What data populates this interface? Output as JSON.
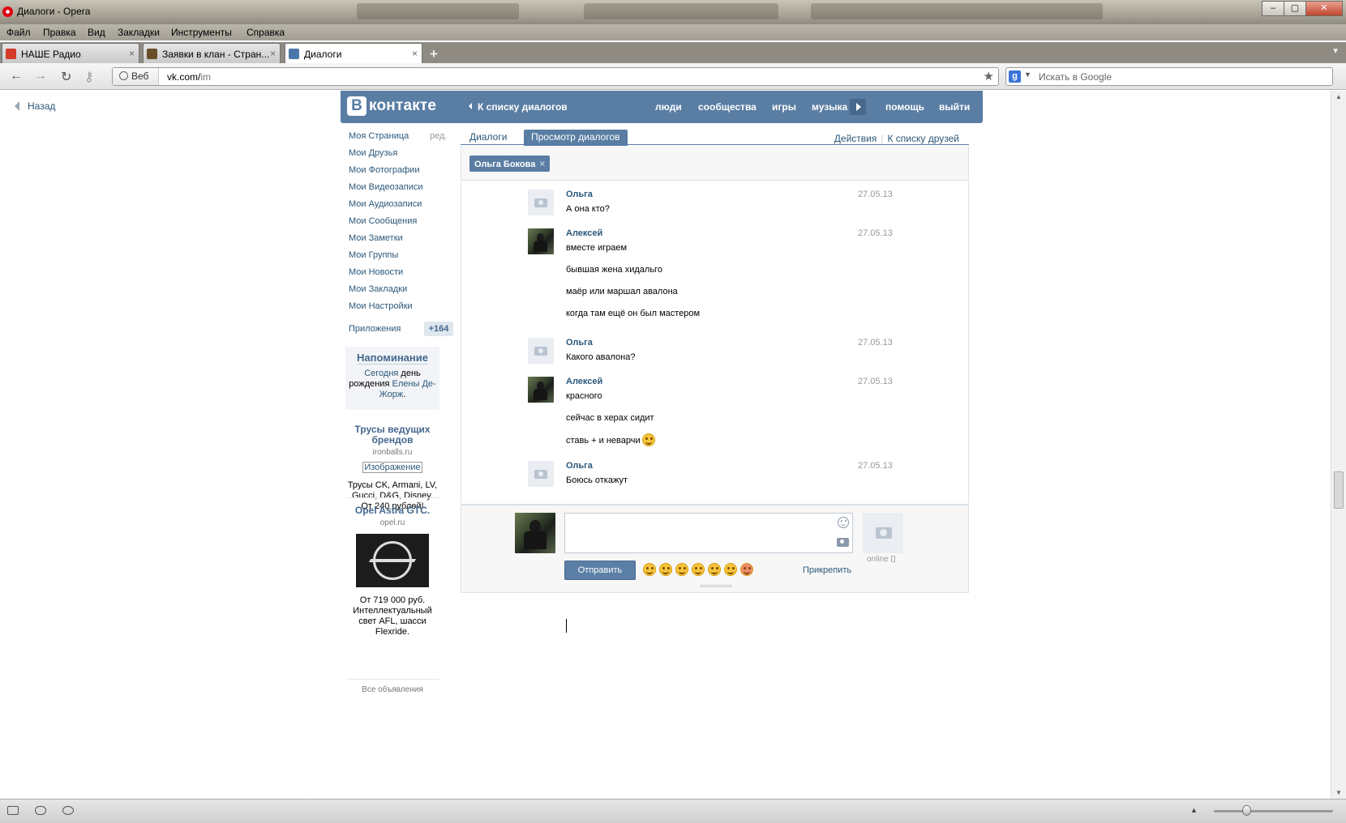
{
  "window": {
    "title": "Диалоги - Opera",
    "controls": [
      "–",
      "▢",
      "✕"
    ]
  },
  "menu": [
    "Файл",
    "Правка",
    "Вид",
    "Закладки",
    "Инструменты",
    "Справка"
  ],
  "tabs": [
    {
      "label": "НАШЕ Радио",
      "close": "×",
      "icon_color": "#d43b2a"
    },
    {
      "label": "Заявки в клан - Стран...",
      "close": "×",
      "icon_color": "#6a4b2a"
    },
    {
      "label": "Диалоги",
      "close": "×",
      "icon_color": "#4a76a8"
    }
  ],
  "toolbar": {
    "web_label": "Веб",
    "url_host": "vk.com/",
    "url_path": "im",
    "search_placeholder": "Искать в Google",
    "search_engine": "g"
  },
  "page": {
    "back": "Назад"
  },
  "vk": {
    "logo_letter": "В",
    "logo_text": "контакте",
    "header_back": "К списку диалогов",
    "nav": [
      "люди",
      "сообщества",
      "игры",
      "музыка",
      "помощь",
      "выйти"
    ],
    "brand_color": "#597da3"
  },
  "sidebar": {
    "items": [
      "Моя Страница",
      "Мои Друзья",
      "Мои Фотографии",
      "Мои Видеозаписи",
      "Мои Аудиозаписи",
      "Мои Сообщения",
      "Мои Заметки",
      "Мои Группы",
      "Мои Новости",
      "Мои Закладки",
      "Мои Настройки"
    ],
    "edit": "ред.",
    "apps_label": "Приложения",
    "apps_count": "+164"
  },
  "reminder": {
    "title": "Напоминание",
    "today": "Сегодня",
    "text1": " день рождения ",
    "name": "Елены Де-Жорж",
    "end": "."
  },
  "ads": [
    {
      "title": "Трусы ведущих брендов",
      "domain": "ironballs.ru",
      "image_link": "Изображение",
      "text": "Трусы CK, Armani, LV, Gucci, D&G, Disney. От 240 рублей!"
    },
    {
      "title": "Opel Astra GTC.",
      "domain": "opel.ru",
      "text": "От 719 000 руб. Интеллектуальный свет AFL, шасси Flexride."
    }
  ],
  "all_ads": "Все объявления",
  "dialogs": {
    "tab_dialogs": "Диалоги",
    "tab_view": "Просмотр диалогов",
    "actions": "Действия",
    "separator": "|",
    "to_friends": "К списку друзей",
    "filter_chip": "Ольга Бокова",
    "chip_close": "×"
  },
  "messages": [
    {
      "author": "Ольга",
      "date": "27.05.13",
      "avatar": "camera",
      "lines": [
        "А она кто?"
      ]
    },
    {
      "author": "Алексей",
      "date": "27.05.13",
      "avatar": "photo",
      "lines": [
        "вместе играем",
        "бывшая жена хидальго",
        "маёр или маршал авалона",
        "когда там ещё он был мастером"
      ]
    },
    {
      "author": "Ольга",
      "date": "27.05.13",
      "avatar": "camera",
      "lines": [
        "Какого авалона?"
      ]
    },
    {
      "author": "Алексей",
      "date": "27.05.13",
      "avatar": "photo",
      "lines": [
        "красного",
        "сейчас в херах сидит",
        "ставь + и неварчи"
      ]
    },
    {
      "author": "Ольга",
      "date": "27.05.13",
      "avatar": "camera",
      "lines": [
        "Боюсь откажут"
      ]
    }
  ],
  "compose": {
    "send": "Отправить",
    "attach": "Прикрепить",
    "online": "online",
    "emoji_count": 7
  }
}
